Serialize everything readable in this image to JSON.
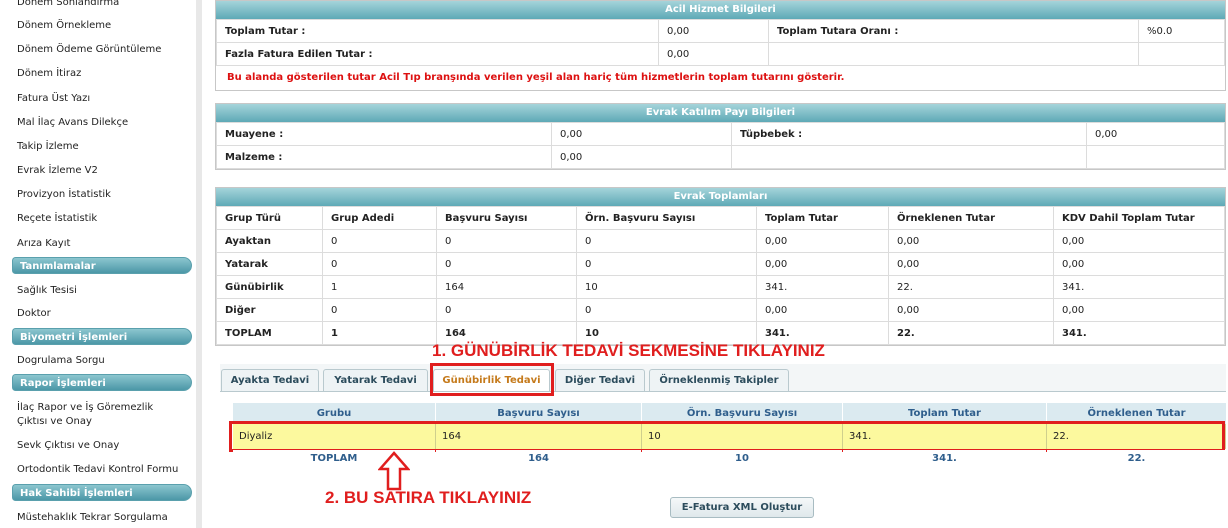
{
  "sidebar": {
    "items_top": [
      "Dönem Sonlandırma",
      "Dönem Örnekleme",
      "Dönem Ödeme Görüntüleme",
      "Dönem İtiraz",
      "Fatura Üst Yazı",
      "Mal İlaç Avans Dilekçe",
      "Takip İzleme",
      "Evrak İzleme V2",
      "Provizyon İstatistik",
      "Reçete İstatistik",
      "Arıza Kayıt"
    ],
    "tanimlamalar": {
      "title": "Tanımlamalar",
      "items": [
        "Sağlık Tesisi",
        "Doktor"
      ]
    },
    "biyometri": {
      "title": "Biyometri İşlemleri",
      "items": [
        "Dogrulama Sorgu"
      ]
    },
    "rapor": {
      "title": "Rapor İşlemleri",
      "items": [
        "İlaç Rapor ve İş Göremezlik",
        "Çıktısı ve Onay",
        "Sevk Çıktısı ve Onay",
        "Ortodontik Tedavi Kontrol Formu"
      ]
    },
    "hak_sahibi": {
      "title": "Hak Sahibi İşlemleri",
      "items": [
        "Müstehaklık Tekrar Sorgulama"
      ]
    }
  },
  "acil": {
    "title": "Acil Hizmet Bilgileri",
    "toplam_tutar_label": "Toplam Tutar :",
    "toplam_tutar_value": "0,00",
    "oran_label": "Toplam Tutara Oranı :",
    "oran_value": "%0.0",
    "fazla_label": "Fazla Fatura Edilen Tutar :",
    "fazla_value": "0,00",
    "note": "Bu alanda gösterilen tutar Acil Tıp branşında verilen yeşil alan hariç tüm hizmetlerin toplam tutarını gösterir."
  },
  "katilim": {
    "title": "Evrak Katılım Payı Bilgileri",
    "muayene_label": "Muayene :",
    "muayene_value": "0,00",
    "tupbebek_label": "Tüpbebek :",
    "tupbebek_value": "0,00",
    "malzeme_label": "Malzeme :",
    "malzeme_value": "0,00"
  },
  "toplamlar": {
    "title": "Evrak Toplamları",
    "headers": [
      "Grup Türü",
      "Grup Adedi",
      "Başvuru Sayısı",
      "Örn. Başvuru Sayısı",
      "Toplam Tutar",
      "Örneklenen Tutar",
      "KDV Dahil Toplam Tutar"
    ],
    "rows": [
      [
        "Ayaktan",
        "0",
        "0",
        "0",
        "0,00",
        "0,00",
        "0,00"
      ],
      [
        "Yatarak",
        "0",
        "0",
        "0",
        "0,00",
        "0,00",
        "0,00"
      ],
      [
        "Günübirlik",
        "1",
        "164",
        "10",
        "341.",
        "22.",
        "341."
      ],
      [
        "Diğer",
        "0",
        "0",
        "0",
        "0,00",
        "0,00",
        "0,00"
      ],
      [
        "TOPLAM",
        "1",
        "164",
        "10",
        "341.",
        "22.",
        "341."
      ]
    ]
  },
  "tabs": [
    "Ayakta Tedavi",
    "Yatarak Tedavi",
    "Günübirlik Tedavi",
    "Diğer Tedavi",
    "Örneklenmiş Takipler"
  ],
  "grid": {
    "headers": [
      "Grubu",
      "Başvuru Sayısı",
      "Örn. Başvuru Sayısı",
      "Toplam Tutar",
      "Örneklenen Tutar"
    ],
    "row": [
      "Diyaliz",
      "164",
      "10",
      "341.",
      "22."
    ],
    "total": [
      "TOPLAM",
      "164",
      "10",
      "341.",
      "22."
    ]
  },
  "annotations": {
    "step1": "1. GÜNÜBİRLİK TEDAVİ SEKMESİNE TIKLAYINIZ",
    "step2": "2. BU SATIRA TIKLAYINIZ"
  },
  "efatura_button": "E-Fatura XML Oluştur",
  "colors": {
    "accent": "#5ea9b6",
    "annotation": "#e01e1e",
    "highlight_row": "#fcf99e"
  }
}
